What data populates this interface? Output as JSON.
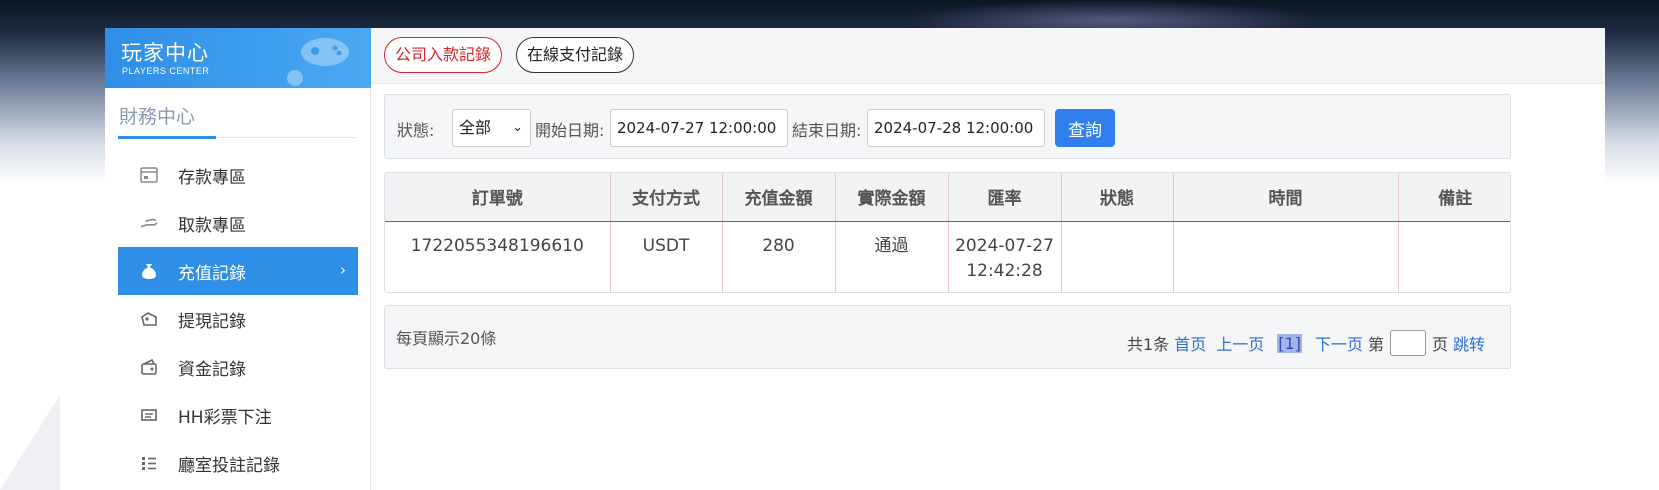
{
  "brand": {
    "title": "玩家中心",
    "subtitle": "PLAYERS CENTER"
  },
  "sidebar": {
    "section_title": "財務中心",
    "items": [
      {
        "label": "存款專區",
        "icon": "card-icon"
      },
      {
        "label": "取款專區",
        "icon": "withdraw-hand-icon"
      },
      {
        "label": "充值記錄",
        "icon": "money-bag-icon",
        "active": true
      },
      {
        "label": "提現記錄",
        "icon": "tag-icon"
      },
      {
        "label": "資金記錄",
        "icon": "wallet-icon"
      },
      {
        "label": "HH彩票下注",
        "icon": "ticket-icon"
      },
      {
        "label": "廳室投註記錄",
        "icon": "list-icon"
      }
    ]
  },
  "tabs": [
    {
      "label": "公司入款記錄",
      "active": true
    },
    {
      "label": "在線支付記錄",
      "active": false
    }
  ],
  "filter": {
    "status_label": "狀態:",
    "status_value": "全部",
    "start_label": "開始日期:",
    "start_value": "2024-07-27 12:00:00",
    "end_label": "結束日期:",
    "end_value": "2024-07-28 12:00:00",
    "query_label": "查詢"
  },
  "table": {
    "columns": [
      "訂單號",
      "支付方式",
      "充值金額",
      "實際金額",
      "匯率",
      "狀態",
      "時間",
      "備註"
    ],
    "rows": [
      [
        "1722055348196610",
        "USDT",
        "280",
        "通過",
        "2024-07-27 12:42:28",
        "",
        "",
        ""
      ]
    ]
  },
  "pager": {
    "per_page": "每頁顯示20條",
    "total": "共1条",
    "first": "首页",
    "prev": "上一页",
    "current": "[1]",
    "next": "下一页",
    "page_prefix": "第",
    "page_suffix": "页",
    "jump": "跳转"
  },
  "colors": {
    "accent": "#2f8ee6",
    "active_tab": "#d9252b",
    "link": "#2f6fd6"
  }
}
